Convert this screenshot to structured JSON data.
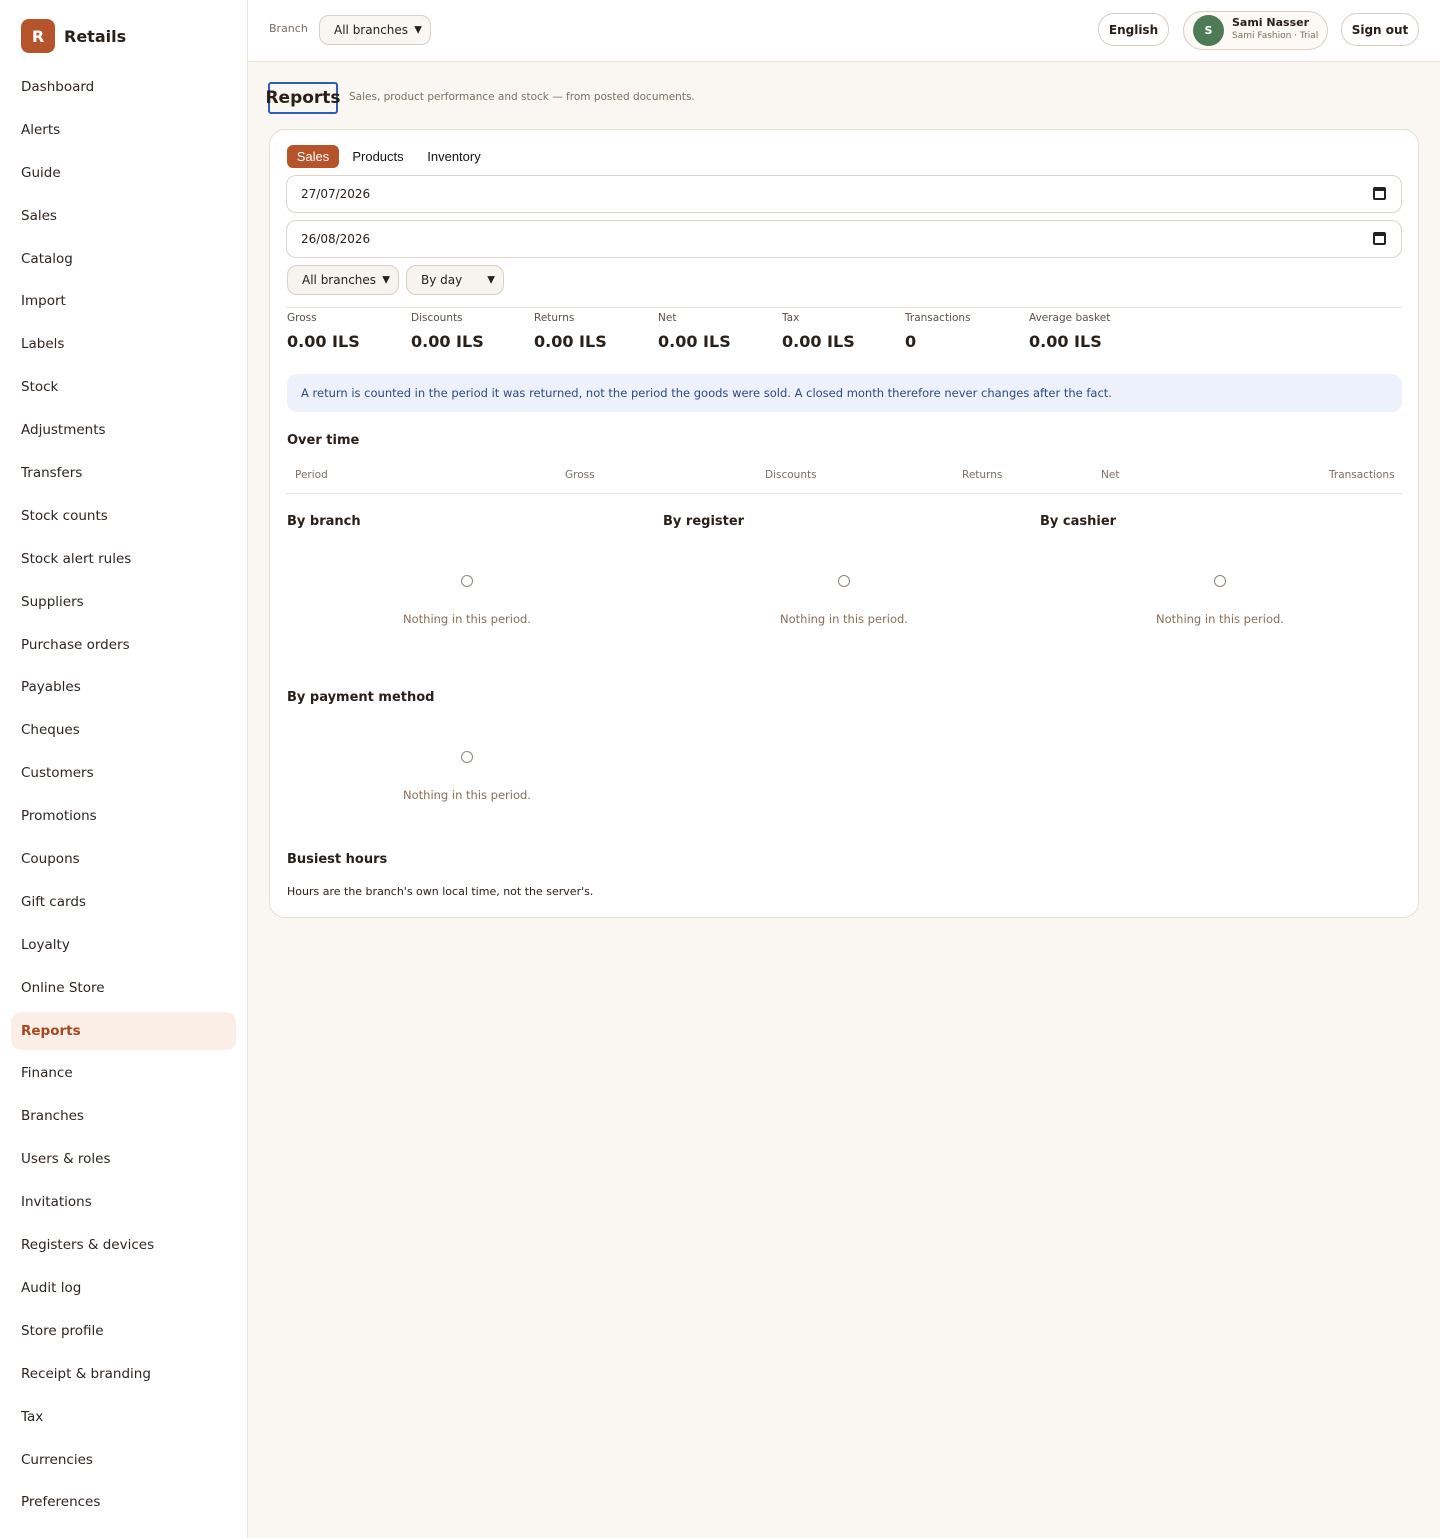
{
  "brand": {
    "logo_letter": "R",
    "name": "Retails"
  },
  "sidebar": {
    "items": [
      {
        "label": "Dashboard"
      },
      {
        "label": "Alerts"
      },
      {
        "label": "Guide"
      },
      {
        "label": "Sales"
      },
      {
        "label": "Catalog"
      },
      {
        "label": "Import"
      },
      {
        "label": "Labels"
      },
      {
        "label": "Stock"
      },
      {
        "label": "Adjustments"
      },
      {
        "label": "Transfers"
      },
      {
        "label": "Stock counts"
      },
      {
        "label": "Stock alert rules"
      },
      {
        "label": "Suppliers"
      },
      {
        "label": "Purchase orders"
      },
      {
        "label": "Payables"
      },
      {
        "label": "Cheques"
      },
      {
        "label": "Customers"
      },
      {
        "label": "Promotions"
      },
      {
        "label": "Coupons"
      },
      {
        "label": "Gift cards"
      },
      {
        "label": "Loyalty"
      },
      {
        "label": "Online Store"
      },
      {
        "label": "Reports",
        "active": true
      },
      {
        "label": "Finance"
      },
      {
        "label": "Branches"
      },
      {
        "label": "Users & roles"
      },
      {
        "label": "Invitations"
      },
      {
        "label": "Registers & devices"
      },
      {
        "label": "Audit log"
      },
      {
        "label": "Store profile"
      },
      {
        "label": "Receipt & branding"
      },
      {
        "label": "Tax"
      },
      {
        "label": "Currencies"
      },
      {
        "label": "Preferences"
      }
    ]
  },
  "topbar": {
    "branch_label": "Branch",
    "branch_select": "All branches",
    "language_button": "English",
    "user": {
      "initial": "S",
      "name": "Sami Nasser",
      "subtitle": "Sami Fashion · Trial",
      "avatar_color": "#4e7a55"
    },
    "sign_out": "Sign out"
  },
  "page": {
    "title": "Reports",
    "subtitle": "Sales, product performance and stock — from posted documents."
  },
  "tabs": [
    {
      "label": "Sales",
      "active": true
    },
    {
      "label": "Products"
    },
    {
      "label": "Inventory"
    }
  ],
  "filters": {
    "date_from": "27/07/2026",
    "date_to": "26/08/2026",
    "branch": "All branches",
    "grouping": "By day"
  },
  "stats": [
    {
      "label": "Gross",
      "value": "0.00 ILS"
    },
    {
      "label": "Discounts",
      "value": "0.00 ILS"
    },
    {
      "label": "Returns",
      "value": "0.00 ILS"
    },
    {
      "label": "Net",
      "value": "0.00 ILS"
    },
    {
      "label": "Tax",
      "value": "0.00 ILS"
    },
    {
      "label": "Transactions",
      "value": "0"
    },
    {
      "label": "Average basket",
      "value": "0.00 ILS"
    }
  ],
  "note": "A return is counted in the period it was returned, not the period the goods were sold. A closed month therefore never changes after the fact.",
  "over_time": {
    "title": "Over time",
    "columns": [
      "Period",
      "Gross",
      "Discounts",
      "Returns",
      "Net",
      "Transactions"
    ]
  },
  "breakdowns": [
    {
      "title": "By branch",
      "empty": "Nothing in this period."
    },
    {
      "title": "By register",
      "empty": "Nothing in this period."
    },
    {
      "title": "By cashier",
      "empty": "Nothing in this period."
    },
    {
      "title": "By payment method",
      "empty": "Nothing in this period."
    }
  ],
  "busiest_hours": {
    "title": "Busiest hours",
    "note": "Hours are the branch's own local time, not the server's."
  },
  "colors": {
    "accent": "#b5532a",
    "note_bg": "#ecf1fb",
    "page_bg": "#faf6f1"
  }
}
